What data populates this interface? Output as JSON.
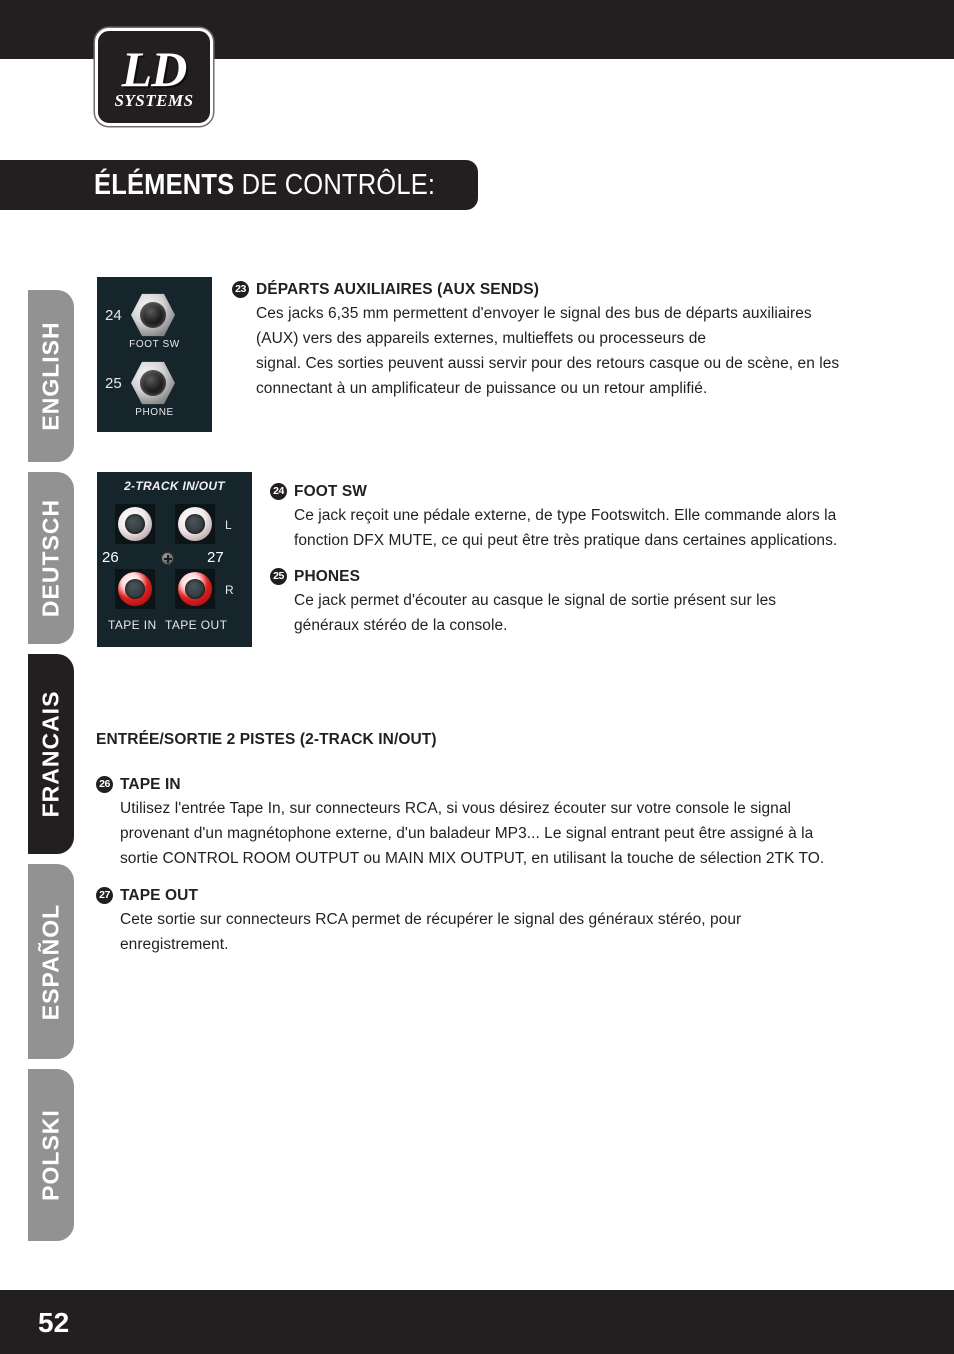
{
  "brand": {
    "logo_line1": "LD",
    "logo_line2": "SYSTEMS"
  },
  "header": {
    "title_strong": "ÉLÉMENTS",
    "title_light": " DE CONTRÔLE:"
  },
  "sidebar": {
    "items": [
      {
        "label": "ENGLISH",
        "active": false
      },
      {
        "label": "DEUTSCH",
        "active": false
      },
      {
        "label": "FRANCAIS",
        "active": true
      },
      {
        "label": "ESPAÑOL",
        "active": false
      },
      {
        "label": "POLSKI",
        "active": false
      }
    ]
  },
  "figures": {
    "jacks_panel": {
      "rows": [
        {
          "number": "24",
          "caption": "FOOT SW"
        },
        {
          "number": "25",
          "caption": "PHONE"
        }
      ]
    },
    "rca_panel": {
      "title": "2-TRACK IN/OUT",
      "channel_top": "L",
      "channel_bottom": "R",
      "number_left": "26",
      "number_right": "27",
      "label_left": "TAPE IN",
      "label_right": "TAPE OUT"
    }
  },
  "content": {
    "item23": {
      "number": "23",
      "title": "DÉPARTS AUXILIAIRES (AUX SENDS)",
      "body": "Ces jacks 6,35 mm permettent d'envoyer le signal des bus de départs auxiliaires (AUX) vers des appareils externes, multieffets ou processeurs de\nsignal. Ces sorties peuvent aussi servir pour des retours casque ou de scène, en les connectant à un amplificateur de puissance ou un retour amplifié."
    },
    "item24": {
      "number": "24",
      "title": "FOOT SW",
      "body": "Ce jack reçoit une pédale externe, de type Footswitch. Elle commande alors la fonction DFX MUTE, ce qui peut être très pratique dans certaines applications."
    },
    "item25": {
      "number": "25",
      "title": "PHONES",
      "body": "Ce jack permet d'écouter au casque le signal de sortie présent sur les généraux stéréo de la console."
    },
    "section_heading": "ENTRÉE/SORTIE 2 PISTES (2-TRACK IN/OUT)",
    "item26": {
      "number": "26",
      "title": "TAPE IN",
      "body": "Utilisez l'entrée Tape In, sur connecteurs RCA, si vous désirez écouter sur votre console le signal provenant d'un magnétophone externe, d'un baladeur MP3... Le signal entrant peut être assigné à la sortie CONTROL ROOM OUTPUT ou MAIN MIX OUTPUT, en utilisant la touche de sélection 2TK TO."
    },
    "item27": {
      "number": "27",
      "title": "TAPE OUT",
      "body": "Cete sortie sur connecteurs RCA permet de récupérer le signal des généraux stéréo, pour enregistrement."
    }
  },
  "footer": {
    "page_number": "52"
  },
  "colors": {
    "ink": "#231f20",
    "tab_inactive": "#929292",
    "panel_bg": "#16242b",
    "rca_red": "#e02020"
  }
}
